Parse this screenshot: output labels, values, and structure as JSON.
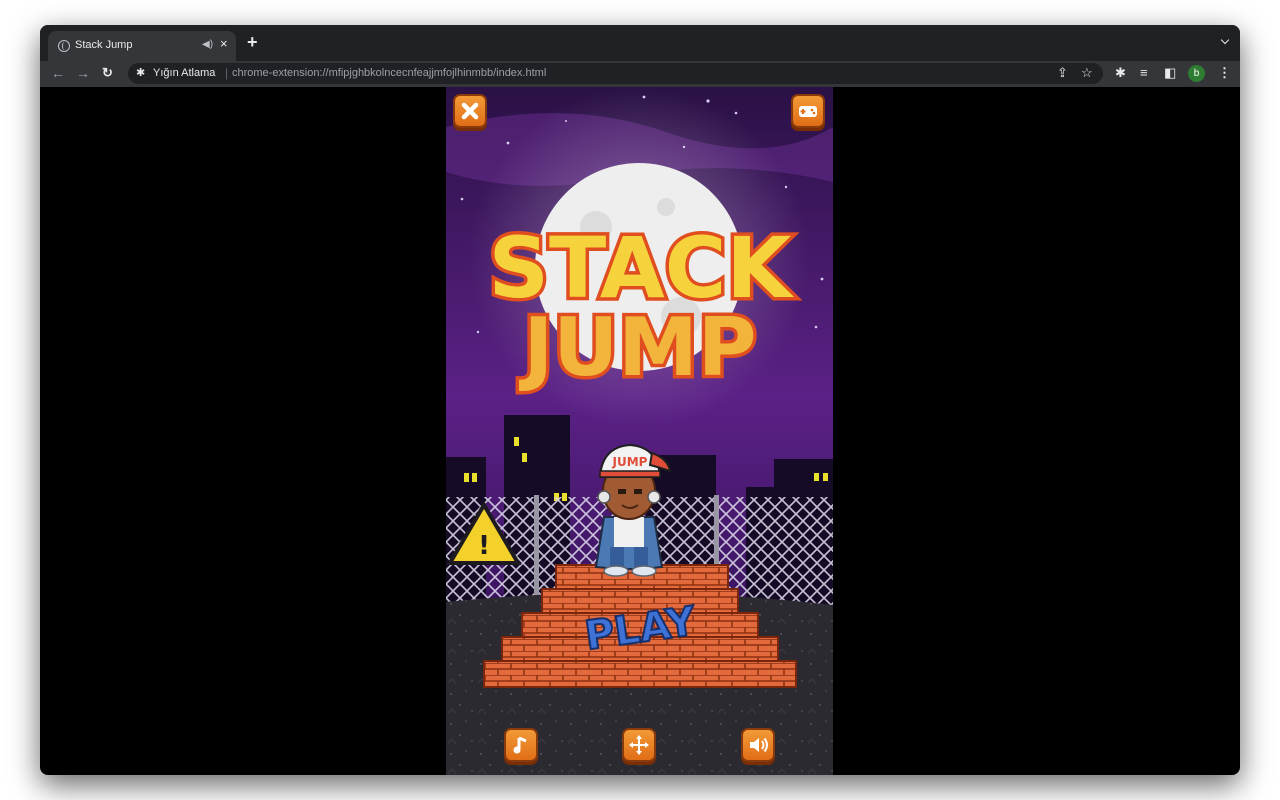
{
  "browser": {
    "tab_title": "Stack Jump",
    "site_name": "Yığın Atlama",
    "url": "chrome-extension://mfipjghbkolncecnfeajjmfojlhinmbb/index.html",
    "profile_initial": "b"
  },
  "game": {
    "title_line1": "STACK",
    "title_line2": "JUMP",
    "cap_text": "JUMP",
    "play_label": "PLAY"
  },
  "colors": {
    "title_fill": "#f6d33c",
    "title_outline": "#e04e20",
    "button_orange": "#f08c2e",
    "sky_top": "#2a1145",
    "sky_mid": "#5b2186",
    "brick": "#e26a3c",
    "play_blue": "#3e72d6",
    "avatar_green": "#2e7d32"
  },
  "icons": [
    "close-icon",
    "gamepad-icon",
    "music-note-icon",
    "move-arrows-icon",
    "speaker-icon"
  ]
}
